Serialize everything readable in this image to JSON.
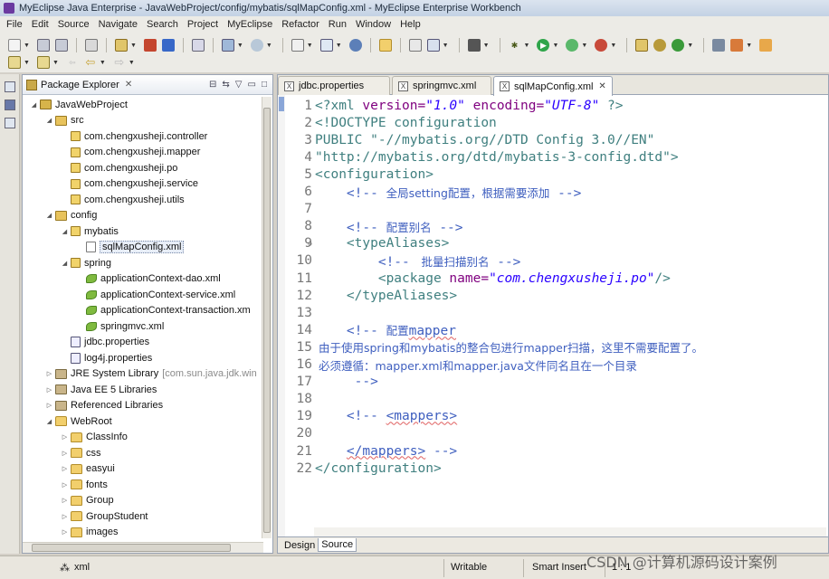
{
  "window": {
    "title": "MyEclipse Java Enterprise - JavaWebProject/config/mybatis/sqlMapConfig.xml - MyEclipse Enterprise Workbench"
  },
  "menu": [
    "File",
    "Edit",
    "Source",
    "Navigate",
    "Search",
    "Project",
    "MyEclipse",
    "Refactor",
    "Run",
    "Window",
    "Help"
  ],
  "explorer": {
    "title": "Package Explorer",
    "tree": [
      {
        "label": "JavaWebProject",
        "icon": "project-icon",
        "depth": 0,
        "twisty": "open"
      },
      {
        "label": "src",
        "icon": "source-folder-icon",
        "depth": 1,
        "twisty": "open"
      },
      {
        "label": "com.chengxusheji.controller",
        "icon": "package-icon",
        "depth": 2,
        "twisty": "none"
      },
      {
        "label": "com.chengxusheji.mapper",
        "icon": "package-icon",
        "depth": 2,
        "twisty": "none"
      },
      {
        "label": "com.chengxusheji.po",
        "icon": "package-icon",
        "depth": 2,
        "twisty": "none"
      },
      {
        "label": "com.chengxusheji.service",
        "icon": "package-icon",
        "depth": 2,
        "twisty": "none"
      },
      {
        "label": "com.chengxusheji.utils",
        "icon": "package-icon",
        "depth": 2,
        "twisty": "none"
      },
      {
        "label": "config",
        "icon": "source-folder-icon",
        "depth": 1,
        "twisty": "open"
      },
      {
        "label": "mybatis",
        "icon": "package-icon",
        "depth": 2,
        "twisty": "open"
      },
      {
        "label": "sqlMapConfig.xml",
        "icon": "xml-file-icon",
        "depth": 3,
        "twisty": "none",
        "selected": true
      },
      {
        "label": "spring",
        "icon": "package-icon",
        "depth": 2,
        "twisty": "open"
      },
      {
        "label": "applicationContext-dao.xml",
        "icon": "spring-file-icon",
        "depth": 3,
        "twisty": "none"
      },
      {
        "label": "applicationContext-service.xml",
        "icon": "spring-file-icon",
        "depth": 3,
        "twisty": "none"
      },
      {
        "label": "applicationContext-transaction.xm",
        "icon": "spring-file-icon",
        "depth": 3,
        "twisty": "none"
      },
      {
        "label": "springmvc.xml",
        "icon": "spring-file-icon",
        "depth": 3,
        "twisty": "none"
      },
      {
        "label": "jdbc.properties",
        "icon": "properties-file-icon",
        "depth": 2,
        "twisty": "none"
      },
      {
        "label": "log4j.properties",
        "icon": "properties-file-icon",
        "depth": 2,
        "twisty": "none"
      },
      {
        "label": "JRE System Library",
        "extra": "[com.sun.java.jdk.win",
        "icon": "library-icon",
        "depth": 1,
        "twisty": "closed"
      },
      {
        "label": "Java EE 5 Libraries",
        "icon": "library-icon",
        "depth": 1,
        "twisty": "closed"
      },
      {
        "label": "Referenced Libraries",
        "icon": "library-icon",
        "depth": 1,
        "twisty": "closed"
      },
      {
        "label": "WebRoot",
        "icon": "folder-icon",
        "depth": 1,
        "twisty": "open"
      },
      {
        "label": "ClassInfo",
        "icon": "folder-icon",
        "depth": 2,
        "twisty": "closed"
      },
      {
        "label": "css",
        "icon": "folder-icon",
        "depth": 2,
        "twisty": "closed"
      },
      {
        "label": "easyui",
        "icon": "folder-icon",
        "depth": 2,
        "twisty": "closed"
      },
      {
        "label": "fonts",
        "icon": "folder-icon",
        "depth": 2,
        "twisty": "closed"
      },
      {
        "label": "Group",
        "icon": "folder-icon",
        "depth": 2,
        "twisty": "closed"
      },
      {
        "label": "GroupStudent",
        "icon": "folder-icon",
        "depth": 2,
        "twisty": "closed"
      },
      {
        "label": "images",
        "icon": "folder-icon",
        "depth": 2,
        "twisty": "closed"
      }
    ]
  },
  "editor": {
    "tabs": [
      {
        "label": "jdbc.properties",
        "active": false
      },
      {
        "label": "springmvc.xml",
        "active": false
      },
      {
        "label": "sqlMapConfig.xml",
        "active": true
      }
    ],
    "lines": [
      {
        "n": "1",
        "parts": [
          [
            "tag",
            "<?xml "
          ],
          [
            "attr",
            "version="
          ],
          [
            "str",
            "\"1.0\""
          ],
          [
            "plain",
            " "
          ],
          [
            "attr",
            "encoding="
          ],
          [
            "str",
            "\"UTF-8\""
          ],
          [
            "tag",
            " ?>"
          ]
        ]
      },
      {
        "n": "2",
        "parts": [
          [
            "doctype",
            "<!DOCTYPE configuration"
          ]
        ]
      },
      {
        "n": "3",
        "parts": [
          [
            "doctype",
            "PUBLIC "
          ],
          [
            "str_plain",
            "\"-//mybatis.org//DTD Config 3.0//EN\""
          ]
        ]
      },
      {
        "n": "4",
        "parts": [
          [
            "str_plain",
            "\"http://mybatis.org/dtd/mybatis-3-config.dtd\""
          ],
          [
            "doctype",
            ">"
          ]
        ]
      },
      {
        "n": "5",
        "parts": [
          [
            "tag",
            "<configuration>"
          ]
        ]
      },
      {
        "n": "6",
        "parts": [
          [
            "plain",
            "    "
          ],
          [
            "comment",
            "<!-- "
          ],
          [
            "comment_cjk",
            "全局setting配置，根据需要添加"
          ],
          [
            "comment",
            " -->"
          ]
        ]
      },
      {
        "n": "7",
        "parts": []
      },
      {
        "n": "8",
        "parts": [
          [
            "plain",
            "    "
          ],
          [
            "comment",
            "<!-- "
          ],
          [
            "comment_cjk",
            "配置别名"
          ],
          [
            "comment",
            " -->"
          ]
        ]
      },
      {
        "n": "9",
        "fold": true,
        "parts": [
          [
            "plain",
            "    "
          ],
          [
            "tag",
            "<typeAliases>"
          ]
        ]
      },
      {
        "n": "10",
        "parts": [
          [
            "plain",
            "        "
          ],
          [
            "comment",
            "<!-- "
          ],
          [
            "comment_cjk",
            " 批量扫描别名"
          ],
          [
            "comment",
            " -->"
          ]
        ]
      },
      {
        "n": "11",
        "parts": [
          [
            "plain",
            "        "
          ],
          [
            "tag",
            "<package "
          ],
          [
            "attr",
            "name="
          ],
          [
            "str",
            "\"com.chengxusheji.po\""
          ],
          [
            "tag",
            "/>"
          ]
        ]
      },
      {
        "n": "12",
        "parts": [
          [
            "plain",
            "    "
          ],
          [
            "tag",
            "</typeAliases>"
          ]
        ]
      },
      {
        "n": "13",
        "parts": []
      },
      {
        "n": "14",
        "parts": [
          [
            "plain",
            "    "
          ],
          [
            "comment",
            "<!-- "
          ],
          [
            "comment_cjk",
            "配置"
          ],
          [
            "comment_spell",
            "mapper"
          ]
        ]
      },
      {
        "n": "15",
        "parts": [
          [
            "comment_cjk",
            " 由于使用spring和mybatis的整合包进行mapper扫描，这里不需要配置了。"
          ]
        ]
      },
      {
        "n": "16",
        "parts": [
          [
            "comment_cjk",
            " 必须遵循：mapper.xml和mapper.java文件同名且在一个目录"
          ]
        ]
      },
      {
        "n": "17",
        "parts": [
          [
            "plain",
            "     "
          ],
          [
            "comment",
            "-->"
          ]
        ]
      },
      {
        "n": "18",
        "parts": []
      },
      {
        "n": "19",
        "parts": [
          [
            "plain",
            "    "
          ],
          [
            "comment",
            "<!-- "
          ],
          [
            "comment_spell",
            "<mappers>"
          ]
        ]
      },
      {
        "n": "20",
        "parts": []
      },
      {
        "n": "21",
        "parts": [
          [
            "plain",
            "    "
          ],
          [
            "comment_spell",
            "</mappers>"
          ],
          [
            "comment",
            " -->"
          ]
        ]
      },
      {
        "n": "22",
        "parts": [
          [
            "tag",
            "</configuration>"
          ]
        ]
      }
    ],
    "bottom_tabs": [
      {
        "label": "Design",
        "active": false
      },
      {
        "label": "Source",
        "active": true
      }
    ]
  },
  "status": {
    "content_type": "xml",
    "writable": "Writable",
    "insert_mode": "Smart Insert",
    "position": "1 : 1"
  },
  "watermark": "CSDN @计算机源码设计案例",
  "colors": {
    "tag": "#3f7f7f",
    "attribute": "#7f007f",
    "string": "#2a00ff",
    "comment": "#3f5fbf"
  }
}
